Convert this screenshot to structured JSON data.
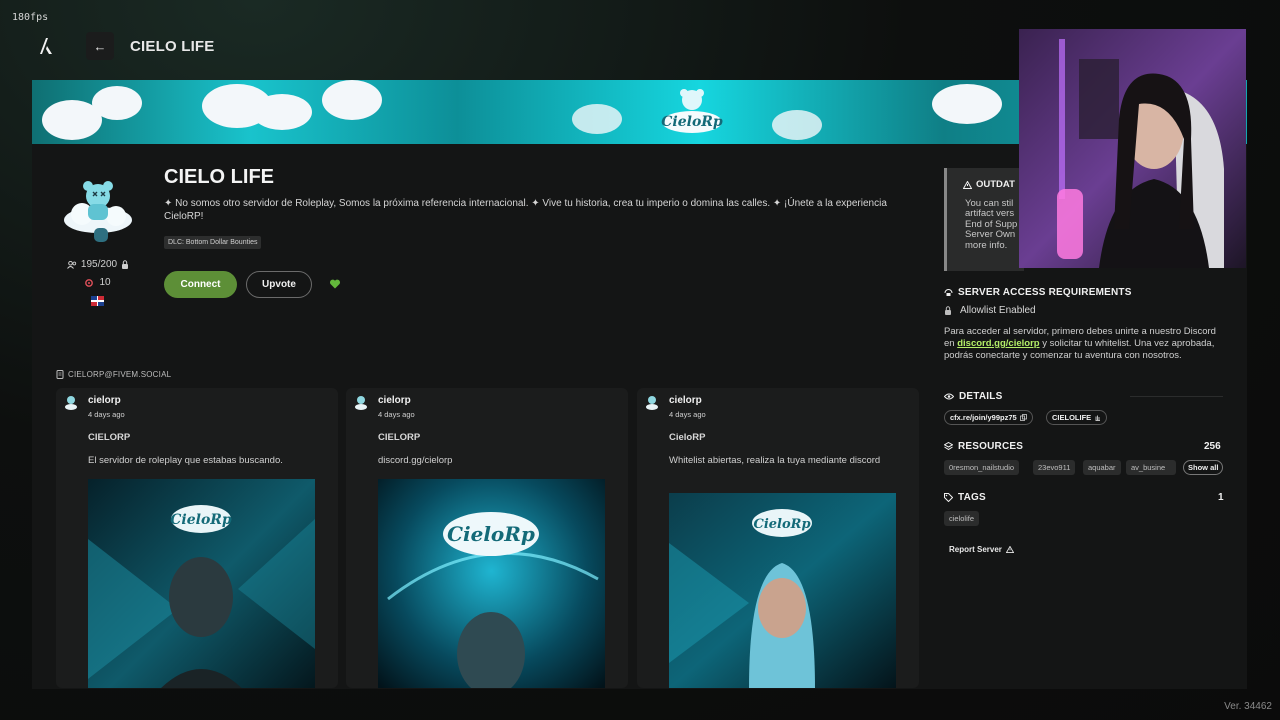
{
  "overlay": {
    "fps": "180fps",
    "version": "Ver. 34462"
  },
  "topbar": {
    "title": "CIELO LIFE",
    "back_icon": "arrow-left-icon"
  },
  "server": {
    "name": "CIELO LIFE",
    "description": "✦ No somos otro servidor de Roleplay, Somos la próxima referencia internacional. ✦ Vive tu historia, crea tu imperio o domina las calles. ✦ ¡Únete a la experiencia CieloRP!",
    "dlc_tag": "DLC: Bottom Dollar Bounties",
    "players": "195/200",
    "boosts": "10",
    "connect_label": "Connect",
    "upvote_label": "Upvote"
  },
  "feed": {
    "handle": "CIELORP@FIVEM.SOCIAL",
    "posts": [
      {
        "user": "cielorp",
        "time": "4 days ago",
        "heading": "CIELORP",
        "text": "El servidor de roleplay que estabas buscando."
      },
      {
        "user": "cielorp",
        "time": "4 days ago",
        "heading": "CIELORP",
        "text": "discord.gg/cielorp"
      },
      {
        "user": "cielorp",
        "time": "4 days ago",
        "heading": "CieloRP",
        "text": "Whitelist abiertas, realiza la tuya mediante discord"
      }
    ]
  },
  "sidebar": {
    "outdated": {
      "title": "OUTDAT",
      "lines": [
        "You can stil",
        "artifact vers",
        "End of Supp",
        "Server Own",
        "more info."
      ]
    },
    "access": {
      "title": "SERVER ACCESS REQUIREMENTS",
      "allowlist": "Allowlist Enabled",
      "text_before": "Para acceder al servidor, primero debes unirte a nuestro Discord en ",
      "link": "discord.gg/cielorp",
      "text_after": " y solicitar tu whitelist. Una vez aprobada, podrás conectarte y comenzar tu aventura con nosotros."
    },
    "details": {
      "title": "DETAILS",
      "join_link": "cfx.re/join/y99pz75",
      "tag_name": "CIELOLIFE"
    },
    "resources": {
      "title": "RESOURCES",
      "count": "256",
      "items": [
        "0resmon_nailstudio",
        "23evo911",
        "aquabar",
        "av_busine"
      ],
      "show_all": "Show all"
    },
    "tags": {
      "title": "TAGS",
      "count": "1",
      "items": [
        "cielolife"
      ]
    },
    "report_label": "Report Server"
  }
}
